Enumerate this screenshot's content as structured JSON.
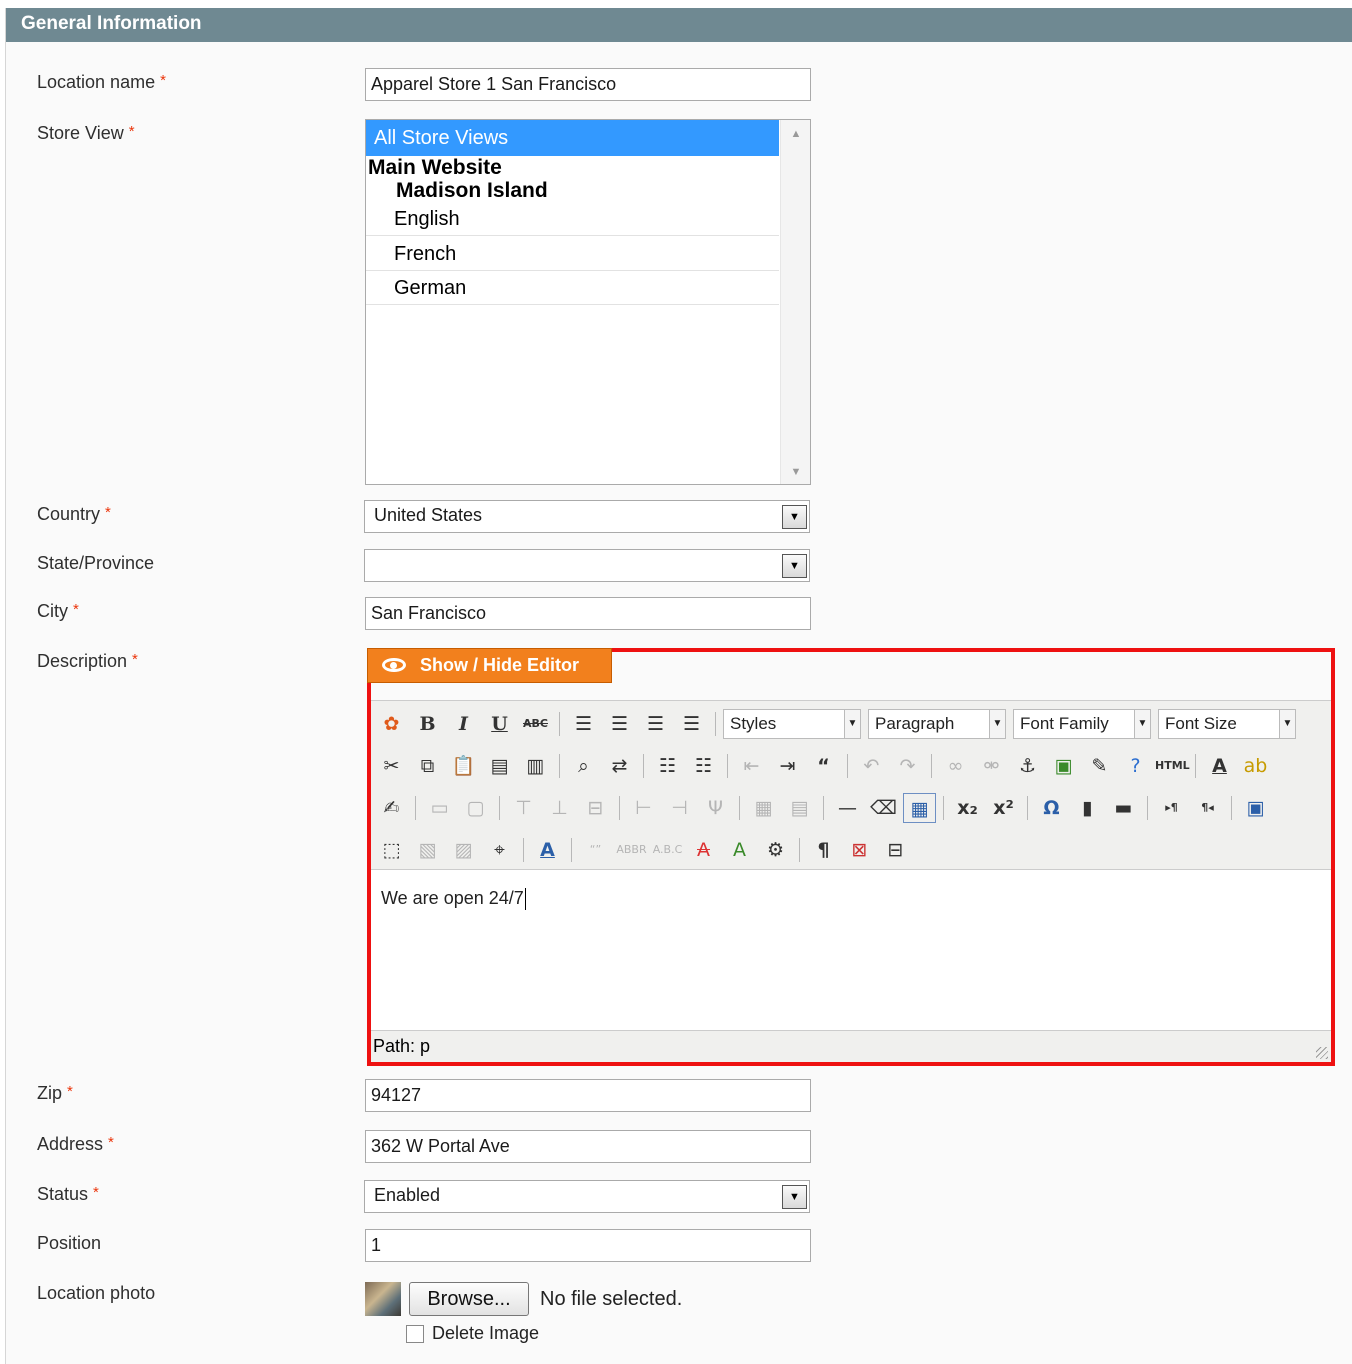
{
  "section": {
    "title": "General Information"
  },
  "form": {
    "required_marker": "*",
    "location_name": {
      "label": "Location name",
      "value": "Apparel Store 1 San Francisco"
    },
    "store_view": {
      "label": "Store View",
      "selected": "All Store Views",
      "website": "Main Website",
      "store": "Madison Island",
      "views": [
        "English",
        "French",
        "German"
      ]
    },
    "country": {
      "label": "Country",
      "value": "United States"
    },
    "state": {
      "label": "State/Province",
      "value": ""
    },
    "city": {
      "label": "City",
      "value": "San Francisco"
    },
    "description": {
      "label": "Description",
      "toggle_label": "Show / Hide Editor",
      "dropdowns": {
        "styles": "Styles",
        "paragraph": "Paragraph",
        "font_family": "Font Family",
        "font_size": "Font Size"
      },
      "content": "We are open 24/7",
      "path": "Path: p"
    },
    "zip": {
      "label": "Zip",
      "value": "94127"
    },
    "address": {
      "label": "Address",
      "value": "362 W Portal Ave"
    },
    "status": {
      "label": "Status",
      "value": "Enabled"
    },
    "position": {
      "label": "Position",
      "value": "1"
    },
    "photo": {
      "label": "Location photo",
      "browse_label": "Browse...",
      "file_status": "No file selected.",
      "delete_label": "Delete Image"
    }
  },
  "colors": {
    "header_bg": "#6f8992",
    "accent_orange": "#f2801d",
    "highlight_red": "#ee1111",
    "selection_blue": "#3399ff"
  }
}
